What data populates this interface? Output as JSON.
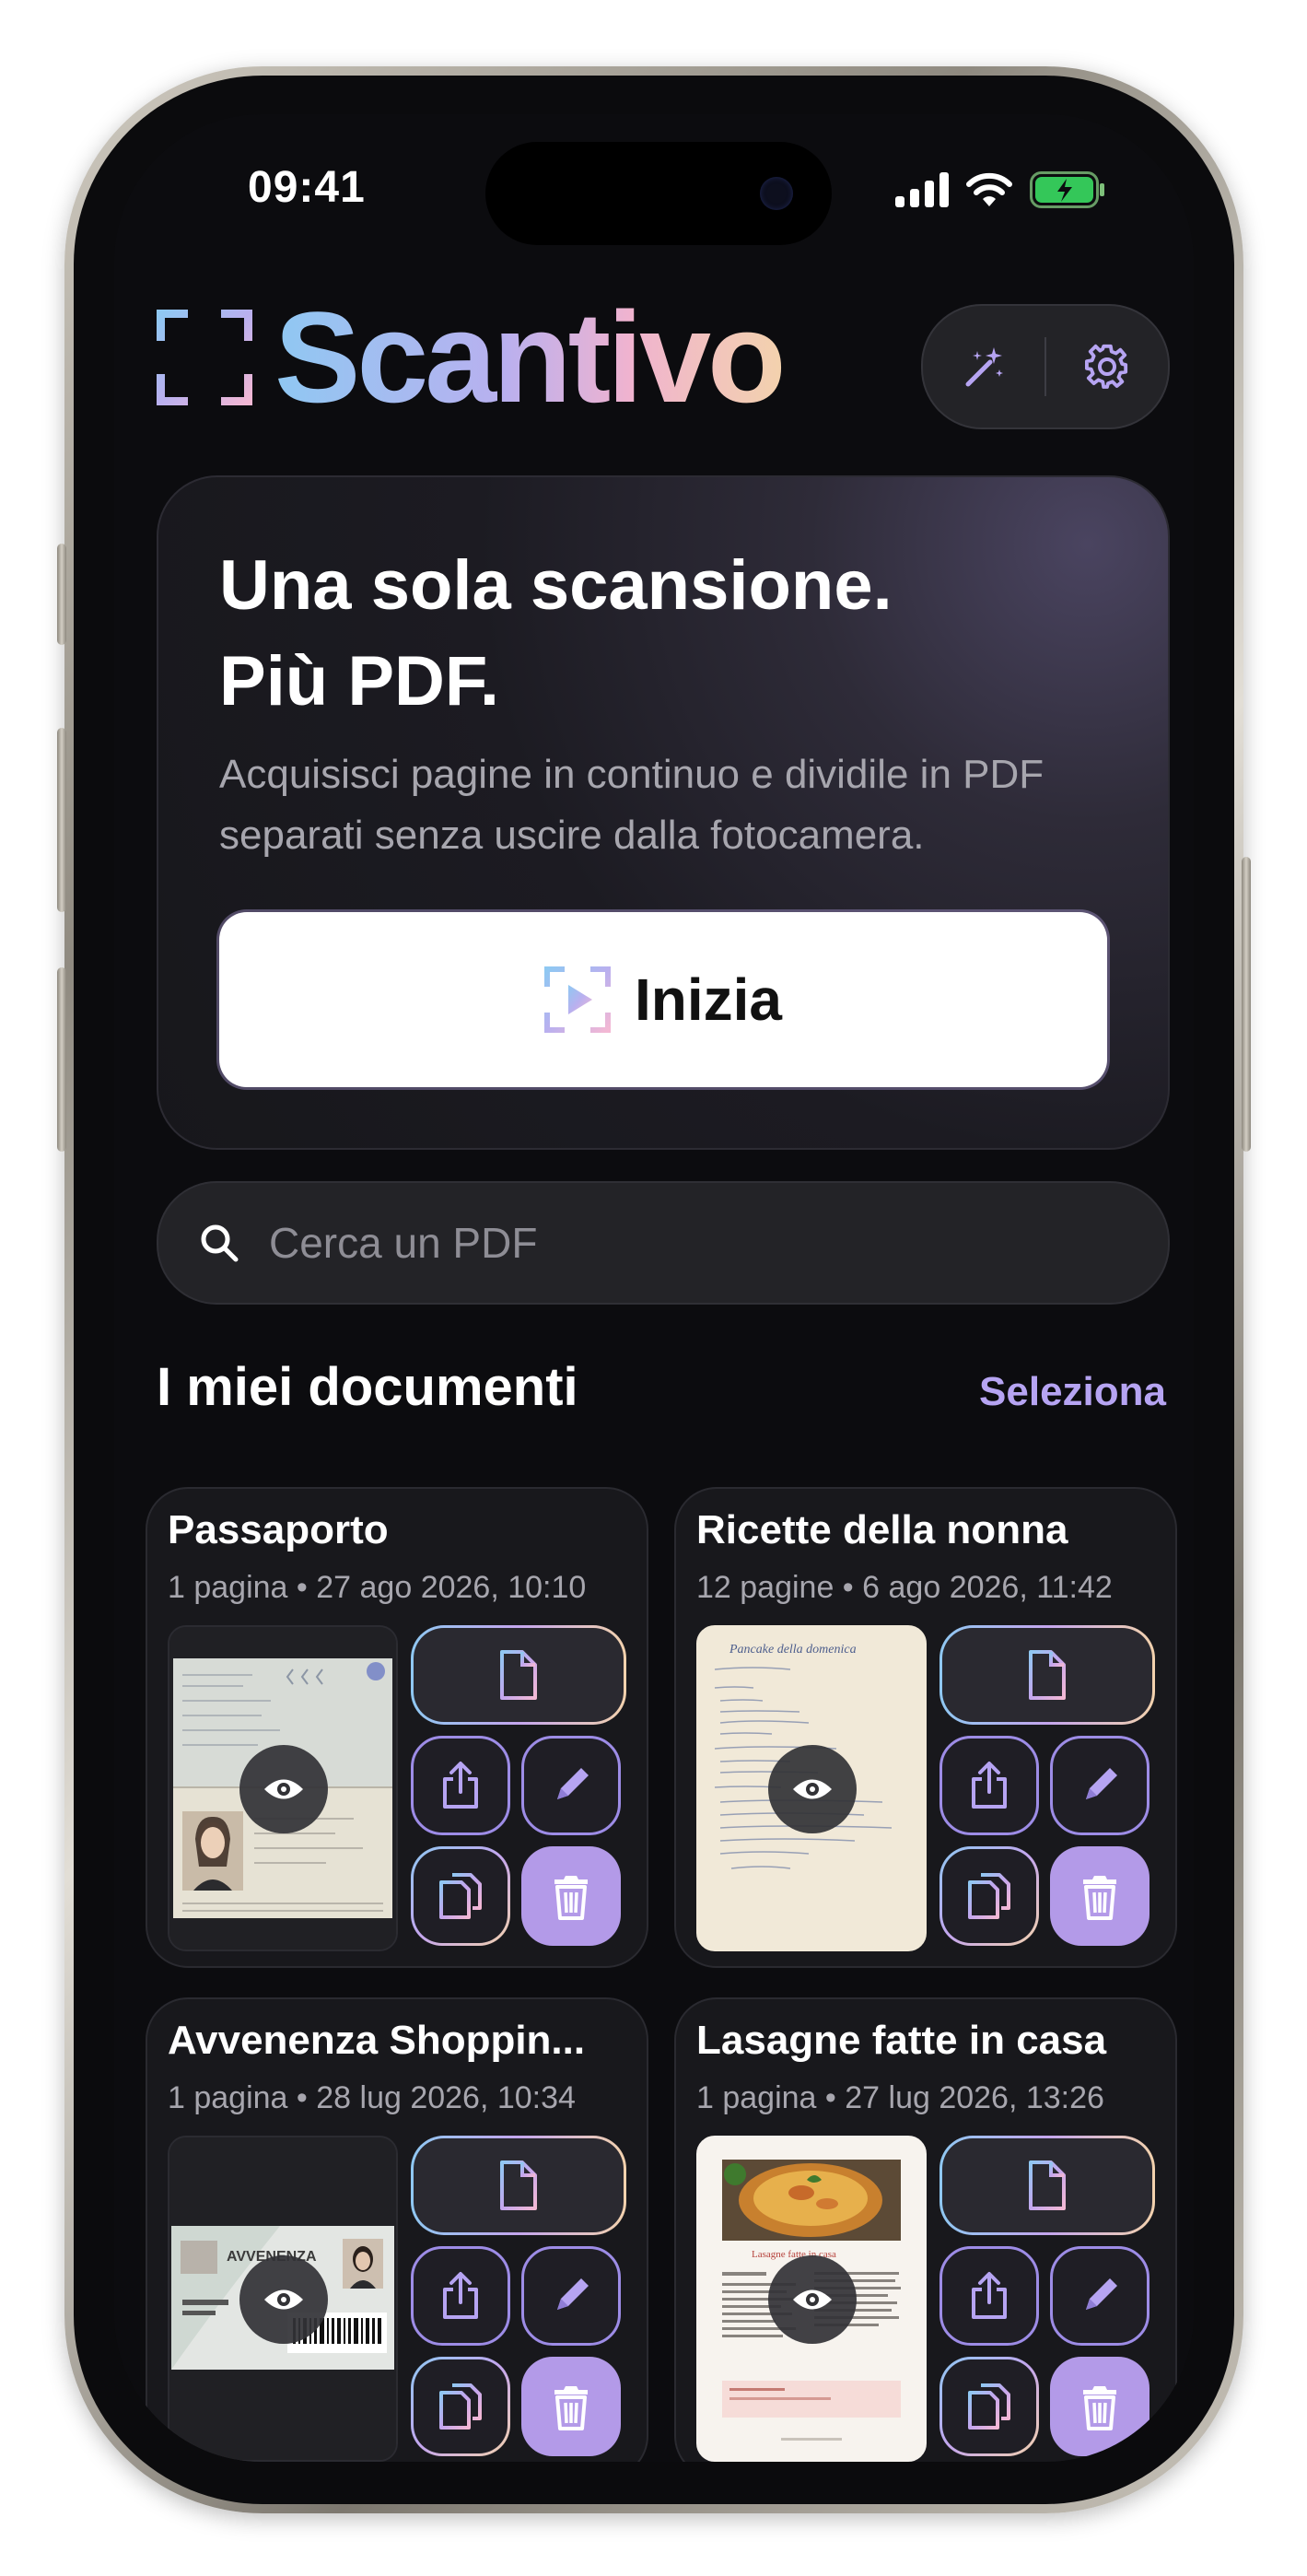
{
  "status_bar": {
    "time": "09:41"
  },
  "header": {
    "app_name": "Scantivo"
  },
  "hero": {
    "title_line1": "Una sola scansione.",
    "title_line2": "Più PDF.",
    "subtitle": "Acquisisci pagine in continuo e dividile in PDF separati senza uscire dalla fotocamera.",
    "start_label": "Inizia"
  },
  "search": {
    "placeholder": "Cerca un PDF"
  },
  "documents": {
    "section_title": "I miei documenti",
    "select_label": "Seleziona",
    "items": [
      {
        "title": "Passaporto",
        "meta": "1 pagina • 27 ago 2026, 10:10",
        "thumbnail": "passport"
      },
      {
        "title": "Ricette della nonna",
        "meta": "12 pagine • 6 ago 2026, 11:42",
        "thumbnail": "handwritten-recipe",
        "thumbnail_text": "Pancake della domenica"
      },
      {
        "title": "Avvenenza Shoppin...",
        "meta": "1 pagina • 28 lug 2026, 10:34",
        "thumbnail": "loyalty-card",
        "thumbnail_text": "AVVENENZA"
      },
      {
        "title": "Lasagne fatte in casa",
        "meta": "1 pagina • 27 lug 2026, 13:26",
        "thumbnail": "recipe-page",
        "thumbnail_text": "Lasagne fatte in casa"
      }
    ]
  },
  "colors": {
    "accent": "#b6a4f2",
    "delete_button": "#b39ae8",
    "background": "#0c0c0f",
    "card": "#18181c"
  },
  "icons": [
    "magic-wand-icon",
    "gear-icon",
    "search-icon",
    "scan-play-icon",
    "eye-icon",
    "pdf-document-icon",
    "share-icon",
    "pencil-icon",
    "copy-icon",
    "trash-icon",
    "signal-icon",
    "wifi-icon",
    "battery-icon"
  ]
}
